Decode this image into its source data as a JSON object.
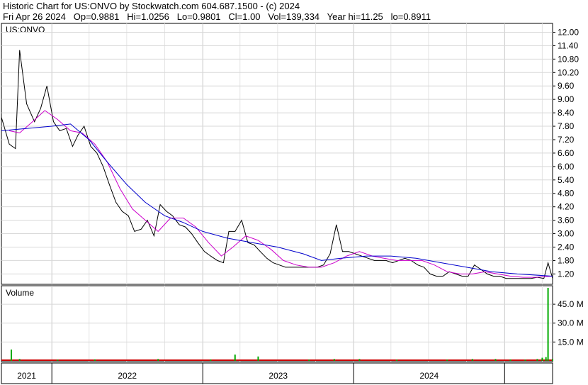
{
  "header": {
    "line1": "Historic Chart for US:ONVO by Stockwatch.com 604.687.1500 - (c) 2024",
    "line2": "Fri Apr 26 2024   Op=0.9881   Hi=1.0256   Lo=0.9801   Cl=1.00   Vol=139,334   Year hi=11.25   lo=0.8911"
  },
  "chart_data": [
    {
      "type": "line",
      "symbol_label": "US:ONVO",
      "y_ticks": [
        "12.00",
        "11.40",
        "10.80",
        "10.20",
        "9.60",
        "9.00",
        "8.40",
        "7.80",
        "7.20",
        "6.60",
        "6.00",
        "5.40",
        "4.80",
        "4.20",
        "3.60",
        "3.00",
        "2.40",
        "1.80",
        "1.20"
      ],
      "ylim": [
        0.8,
        12.3
      ],
      "x_ticks": [
        "2021",
        "2022",
        "2023",
        "2024"
      ],
      "x_range": [
        "2020-09-01",
        "2024-04-26"
      ],
      "series": [
        {
          "color": "#000000",
          "x": [
            "2020-09-01",
            "2020-09-20",
            "2020-10-05",
            "2020-10-15",
            "2020-11-01",
            "2020-11-20",
            "2020-12-05",
            "2020-12-20",
            "2021-01-05",
            "2021-01-20",
            "2021-02-05",
            "2021-02-20",
            "2021-03-05",
            "2021-03-20",
            "2021-04-05",
            "2021-04-20",
            "2021-05-05",
            "2021-05-20",
            "2021-06-05",
            "2021-06-20",
            "2021-07-05",
            "2021-07-20",
            "2021-08-05",
            "2021-08-20",
            "2021-09-05",
            "2021-09-20",
            "2021-10-05",
            "2021-10-20",
            "2021-11-05",
            "2021-11-20",
            "2021-12-05",
            "2021-12-20",
            "2022-01-05",
            "2022-01-20",
            "2022-02-05",
            "2022-02-20",
            "2022-03-05",
            "2022-03-20",
            "2022-04-05",
            "2022-04-20",
            "2022-05-05",
            "2022-05-20",
            "2022-06-05",
            "2022-06-20",
            "2022-07-05",
            "2022-07-20",
            "2022-08-05",
            "2022-08-20",
            "2022-09-05",
            "2022-09-20",
            "2022-10-05",
            "2022-10-20",
            "2022-11-05",
            "2022-11-20",
            "2022-12-05",
            "2022-12-20",
            "2023-01-05",
            "2023-01-20",
            "2023-02-05",
            "2023-02-20",
            "2023-03-05",
            "2023-03-20",
            "2023-04-05",
            "2023-04-20",
            "2023-05-05",
            "2023-05-20",
            "2023-06-05",
            "2023-06-20",
            "2023-07-05",
            "2023-07-20",
            "2023-08-05",
            "2023-08-20",
            "2023-09-05",
            "2023-09-20",
            "2023-10-05",
            "2023-10-20",
            "2023-11-05",
            "2023-11-20",
            "2023-12-05",
            "2023-12-20",
            "2024-01-05",
            "2024-01-20",
            "2024-02-05",
            "2024-02-20",
            "2024-03-05",
            "2024-03-20",
            "2024-04-05",
            "2024-04-15",
            "2024-04-26"
          ],
          "y": [
            8.2,
            7.0,
            6.8,
            11.2,
            8.8,
            8.0,
            8.6,
            9.6,
            8.0,
            7.6,
            7.7,
            6.9,
            7.4,
            7.8,
            6.9,
            6.6,
            6.0,
            5.2,
            4.4,
            4.0,
            3.8,
            3.1,
            3.2,
            3.6,
            2.9,
            4.3,
            4.0,
            3.8,
            3.4,
            3.3,
            3.0,
            2.6,
            2.2,
            2.0,
            1.8,
            1.7,
            3.1,
            3.1,
            3.6,
            2.6,
            2.5,
            2.2,
            1.9,
            1.7,
            1.6,
            1.5,
            1.5,
            1.5,
            1.5,
            1.5,
            1.5,
            1.6,
            2.1,
            3.4,
            2.2,
            2.2,
            2.1,
            2.0,
            1.9,
            1.8,
            1.8,
            1.8,
            1.7,
            1.8,
            1.9,
            1.8,
            1.6,
            1.5,
            1.2,
            1.1,
            1.1,
            1.3,
            1.2,
            1.1,
            1.1,
            1.6,
            1.4,
            1.2,
            1.1,
            1.1,
            1.0,
            1.0,
            1.0,
            1.0,
            1.0,
            1.05,
            1.0,
            1.7,
            1.0
          ]
        },
        {
          "color": "#cc00cc",
          "x": [
            "2020-09-20",
            "2020-10-15",
            "2020-11-15",
            "2020-12-15",
            "2021-01-15",
            "2021-02-15",
            "2021-03-15",
            "2021-04-15",
            "2021-05-15",
            "2021-06-15",
            "2021-07-15",
            "2021-08-15",
            "2021-09-15",
            "2021-10-15",
            "2021-11-15",
            "2021-12-15",
            "2022-01-15",
            "2022-02-15",
            "2022-03-15",
            "2022-04-15",
            "2022-05-15",
            "2022-06-15",
            "2022-07-15",
            "2022-08-15",
            "2022-09-15",
            "2022-10-15",
            "2022-11-15",
            "2022-12-15",
            "2023-01-15",
            "2023-02-15",
            "2023-03-15",
            "2023-04-15",
            "2023-05-15",
            "2023-06-15",
            "2023-07-15",
            "2023-08-15",
            "2023-09-15",
            "2023-10-15",
            "2023-11-15",
            "2023-12-15",
            "2024-01-15",
            "2024-02-15",
            "2024-03-15",
            "2024-04-26"
          ],
          "y": [
            7.6,
            7.5,
            8.0,
            8.5,
            8.1,
            7.6,
            7.5,
            7.0,
            6.2,
            5.0,
            4.1,
            3.6,
            3.1,
            3.7,
            3.7,
            3.3,
            2.6,
            2.0,
            2.4,
            2.9,
            2.7,
            2.3,
            1.8,
            1.6,
            1.5,
            1.5,
            1.7,
            2.0,
            2.2,
            2.0,
            1.9,
            1.8,
            1.8,
            1.8,
            1.6,
            1.3,
            1.2,
            1.2,
            1.3,
            1.2,
            1.1,
            1.05,
            1.05,
            1.1
          ]
        },
        {
          "color": "#0000cc",
          "x": [
            "2020-09-01",
            "2021-01-01",
            "2021-02-15",
            "2021-04-01",
            "2021-05-15",
            "2021-07-01",
            "2021-08-15",
            "2021-10-01",
            "2021-11-15",
            "2022-01-01",
            "2022-03-01",
            "2022-05-01",
            "2022-07-01",
            "2022-09-01",
            "2022-10-15",
            "2022-12-01",
            "2023-02-01",
            "2023-04-01",
            "2023-06-01",
            "2023-08-01",
            "2023-10-01",
            "2023-12-01",
            "2024-02-01",
            "2024-04-26"
          ],
          "y": [
            7.6,
            7.8,
            7.9,
            7.2,
            6.2,
            5.2,
            4.4,
            3.8,
            3.5,
            3.1,
            2.8,
            2.6,
            2.4,
            2.1,
            1.8,
            1.9,
            2.0,
            2.0,
            1.9,
            1.7,
            1.5,
            1.3,
            1.2,
            1.1
          ]
        }
      ]
    },
    {
      "type": "bar",
      "title": "Volume",
      "y_ticks": [
        "45.0 M",
        "30.0 M",
        "15.0 M"
      ],
      "ylim": [
        0,
        58
      ],
      "x": [
        "2020-09-25",
        "2020-10-15",
        "2021-01-15",
        "2021-04-15",
        "2021-09-15",
        "2022-01-20",
        "2022-03-20",
        "2022-05-15",
        "2022-09-15",
        "2022-11-15",
        "2023-01-15",
        "2023-04-15",
        "2023-08-15",
        "2023-10-15",
        "2023-12-10",
        "2024-01-15",
        "2024-02-20",
        "2024-03-20",
        "2024-04-01",
        "2024-04-10",
        "2024-04-15",
        "2024-04-26"
      ],
      "values": [
        9.0,
        1.5,
        1.0,
        1.2,
        1.5,
        1.2,
        5.0,
        3.5,
        1.0,
        1.5,
        1.5,
        1.0,
        1.0,
        1.5,
        1.5,
        1.2,
        1.0,
        1.5,
        2.5,
        3.0,
        58.0,
        1.5
      ]
    }
  ]
}
